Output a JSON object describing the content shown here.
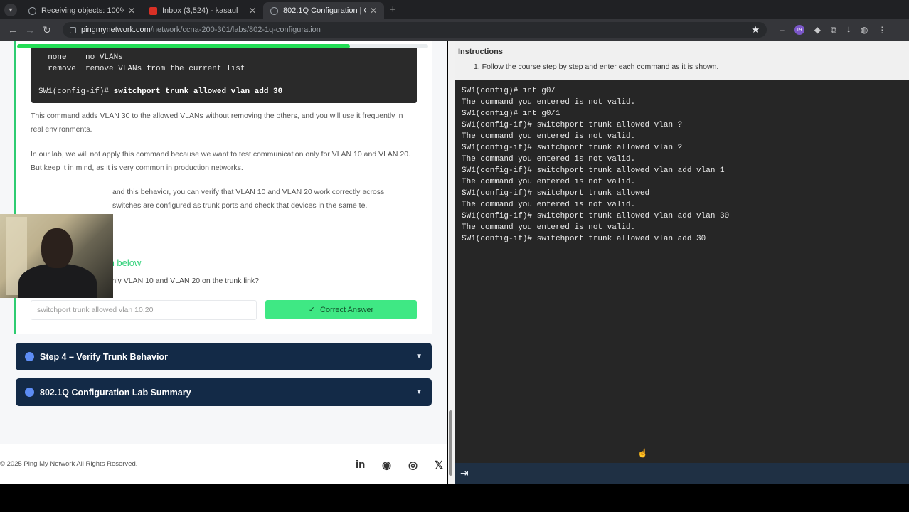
{
  "browser": {
    "tabs": [
      {
        "label": "Receiving objects: 100%",
        "icon": "generic-favicon"
      },
      {
        "label": "Inbox (3,524) - kasaul",
        "icon": "gmail-icon"
      },
      {
        "label": "802.1Q Configuration | C",
        "icon": "generic-favicon"
      }
    ],
    "url_host": "pingmynetwork.com",
    "url_path": "/network/ccna-200-301/labs/802-1q-configuration",
    "ext_badge": "19"
  },
  "course": {
    "code_lines": [
      "  none    no VLANs",
      "  remove  remove VLANs from the current list"
    ],
    "code_prompt": "SW1(config-if)# ",
    "code_command": "switchport trunk allowed vlan add 30",
    "para1": "This command adds VLAN 30 to the allowed VLANs without removing the others, and you will use it frequently in real environments.",
    "para2": "In our lab, we will not apply this command because we want to test communication only for VLAN 10 and VLAN 20. But keep it in mind, as it is very common in production networks.",
    "para3": "and this behavior, you can verify that VLAN 10 and VLAN 20 work correctly across switches are configured as trunk ports and check that devices in the same te.",
    "answer_heading": "Answer the question below",
    "question": "What command allows only VLAN 10 and VLAN 20 on the trunk link?",
    "answer_value": "switchport trunk allowed vlan 10,20",
    "answer_button": "Correct Answer",
    "progress_percent": 81,
    "accordions": [
      {
        "label": "Step 4 – Verify Trunk Behavior"
      },
      {
        "label": "802.1Q Configuration Lab Summary"
      }
    ],
    "footer": {
      "copyright": "© 2025 Ping My Network All Rights Reserved.",
      "social": [
        "linkedin-icon",
        "reddit-icon",
        "instagram-icon",
        "x-icon"
      ]
    }
  },
  "instructions": {
    "title": "Instructions",
    "step": "1. Follow the course step by step and enter each command as it is shown."
  },
  "terminal": {
    "lines": [
      "SW1(config)# int g0/",
      "The command you entered is not valid.",
      "SW1(config)# int g0/1",
      "SW1(config-if)# switchport trunk allowed vlan ?",
      "The command you entered is not valid.",
      "SW1(config-if)# switchport trunk allowed vlan ?",
      "The command you entered is not valid.",
      "SW1(config-if)# switchport trunk allowed vlan add vlan 1",
      "The command you entered is not valid.",
      "SW1(config-if)# switchport trunk allowed",
      "The command you entered is not valid.",
      "SW1(config-if)# switchport trunk allowed vlan add vlan 30",
      "The command you entered is not valid.",
      "SW1(config-if)# switchport trunk allowed vlan add 30"
    ]
  }
}
